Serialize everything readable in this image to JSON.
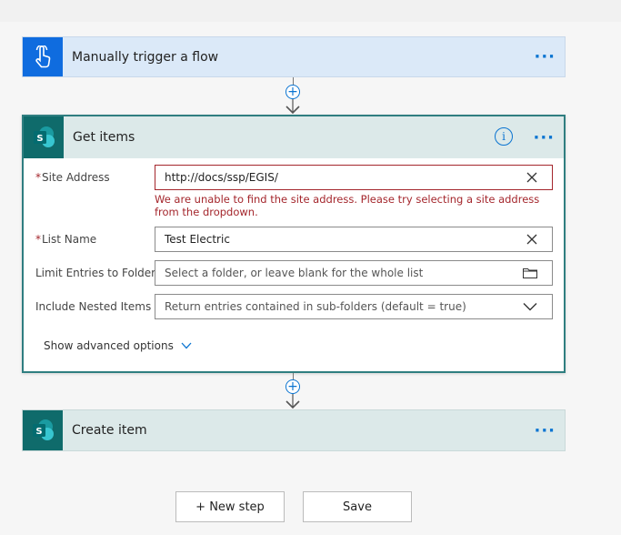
{
  "trigger": {
    "title": "Manually trigger a flow",
    "more_label": "···",
    "icon": "touch-hand-icon"
  },
  "get_items": {
    "title": "Get items",
    "more_label": "···",
    "info_label": "i",
    "fields": {
      "site_address": {
        "required_mark": "*",
        "label": "Site Address",
        "value": "http://docs/ssp/EGIS/",
        "error": "We are unable to find the site address. Please try selecting a site address from the dropdown."
      },
      "list_name": {
        "required_mark": "*",
        "label": "List Name",
        "value": "Test Electric"
      },
      "limit_folder": {
        "label": "Limit Entries to Folder",
        "placeholder": "Select a folder, or leave blank for the whole list"
      },
      "nested": {
        "label": "Include Nested Items",
        "value": "Return entries contained in sub-folders (default = true)"
      }
    },
    "advanced_label": "Show advanced options"
  },
  "create_item": {
    "title": "Create item",
    "more_label": "···"
  },
  "buttons": {
    "new_step": "+ New step",
    "save": "Save"
  },
  "colors": {
    "accent": "#0a74d1",
    "sharepoint": "#0f6b6b",
    "trigger": "#0f6cdf",
    "error": "#a4262c",
    "card_border": "#2f7e80"
  }
}
